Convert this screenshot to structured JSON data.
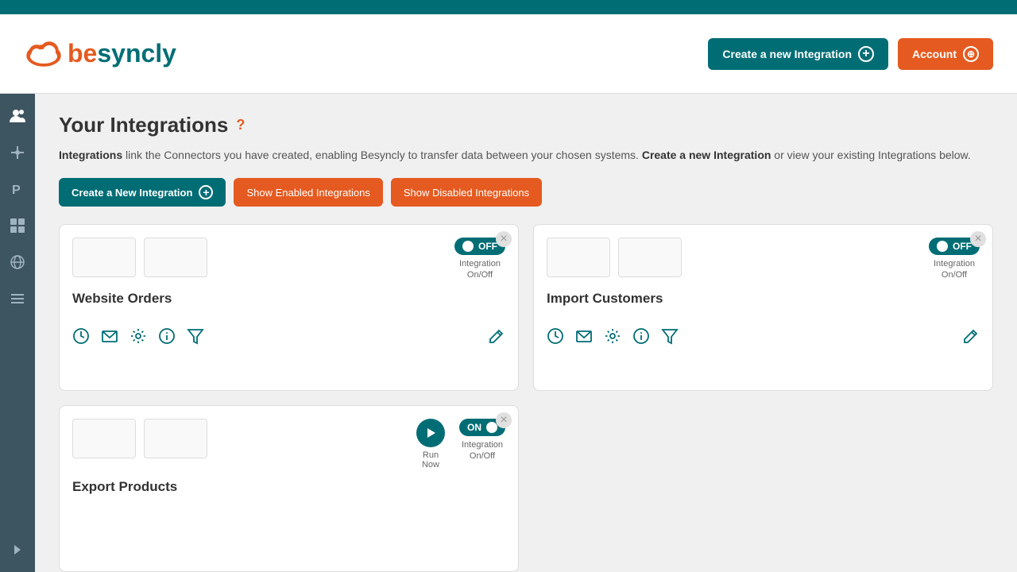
{
  "topBar": {},
  "header": {
    "logoText": "besyncly",
    "createIntegrationButton": "Create a new Integration",
    "accountButton": "Account"
  },
  "sidebar": {
    "icons": [
      {
        "name": "users-icon",
        "symbol": "👤"
      },
      {
        "name": "plugin-icon",
        "symbol": "🔌"
      },
      {
        "name": "code-icon",
        "symbol": "P"
      },
      {
        "name": "layers-icon",
        "symbol": "📋"
      },
      {
        "name": "globe-icon",
        "symbol": "🌐"
      },
      {
        "name": "list-icon",
        "symbol": "☰"
      }
    ],
    "collapseButton": "❯"
  },
  "main": {
    "pageTitle": "Your Integrations",
    "helpIcon": "?",
    "description1": "Integrations",
    "description1Rest": " link the Connectors you have created, enabling Besyncly to transfer data between your chosen systems. ",
    "description2": "Create a new Integration",
    "description2Rest": " or view your existing Integrations below.",
    "buttons": {
      "createNew": "Create a New Integration",
      "showEnabled": "Show Enabled Integrations",
      "showDisabled": "Show Disabled Integrations"
    },
    "cards": [
      {
        "id": "card-website-orders",
        "title": "Website Orders",
        "toggle": "OFF",
        "toggleLabel": "Integration\nOn/Off",
        "enabled": false
      },
      {
        "id": "card-import-customers",
        "title": "Import Customers",
        "toggle": "OFF",
        "toggleLabel": "Integration\nOn/Off",
        "enabled": false
      },
      {
        "id": "card-export-products",
        "title": "Export Products",
        "toggle": "ON",
        "toggleLabel": "Integration\nOn/Off",
        "enabled": true,
        "hasRunNow": true,
        "runNowLabel": "Run\nNow"
      }
    ]
  }
}
